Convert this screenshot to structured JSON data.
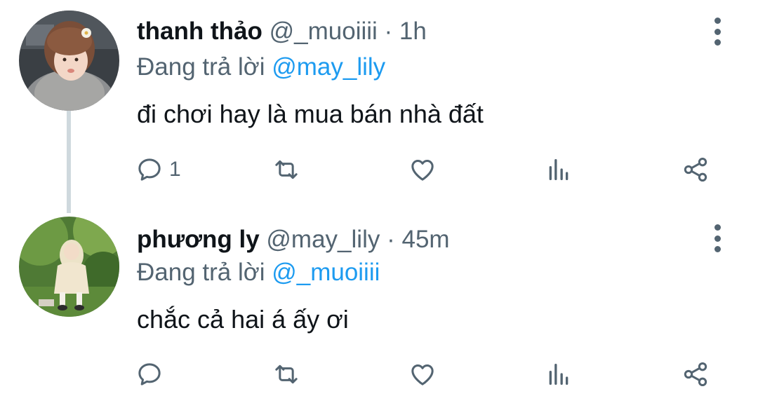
{
  "tweets": [
    {
      "name": "thanh thảo",
      "handle": "@_muoiiii",
      "separator": "·",
      "time": "1h",
      "reply_prefix": "Đang trả lời",
      "reply_mention": "@may_lily",
      "text": "đi chơi hay là mua bán nhà đất",
      "reply_count": "1",
      "icons": [
        "reply-icon",
        "retweet-icon",
        "like-icon",
        "analytics-icon",
        "share-icon",
        "more-icon"
      ]
    },
    {
      "name": "phương ly",
      "handle": "@may_lily",
      "separator": "·",
      "time": "45m",
      "reply_prefix": "Đang trả lời",
      "reply_mention": "@_muoiiii",
      "text": "chắc cả hai á ấy ơi",
      "reply_count": "",
      "icons": [
        "reply-icon",
        "retweet-icon",
        "like-icon",
        "analytics-icon",
        "share-icon",
        "more-icon"
      ]
    }
  ],
  "colors": {
    "text_primary": "#0f1419",
    "text_secondary": "#536471",
    "mention": "#1d9bf0",
    "thread_line": "#cfd9de"
  }
}
